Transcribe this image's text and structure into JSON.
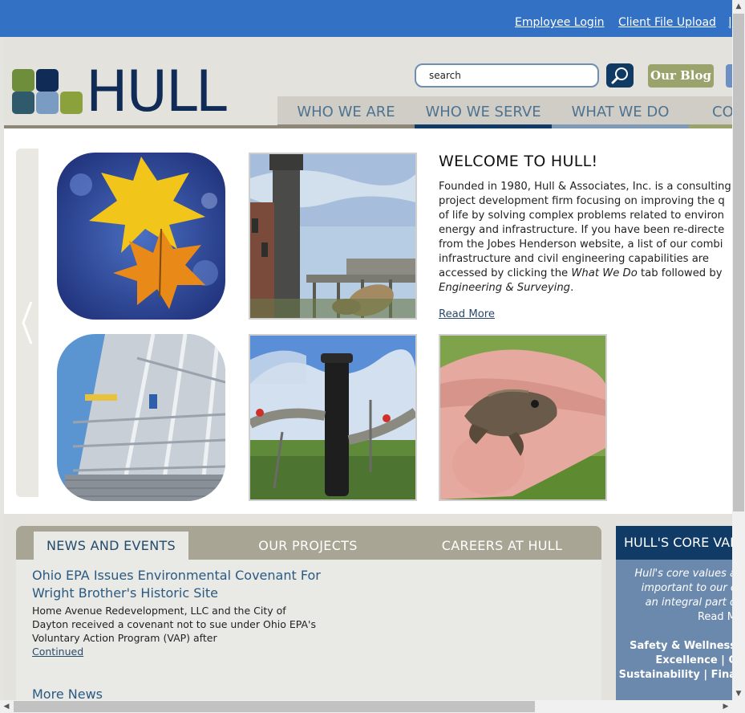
{
  "topbar": {
    "employee_login": "Employee Login",
    "client_upload": "Client File Upload"
  },
  "logo": {
    "wordmark": "HULL"
  },
  "search": {
    "value": "search",
    "icon": "magnifier-icon"
  },
  "blog_button": "Our Blog",
  "nav": {
    "tabs": [
      {
        "label": "WHO WE ARE",
        "underline": "#8d8779"
      },
      {
        "label": "WHO WE SERVE",
        "underline": "#103b66"
      },
      {
        "label": "WHAT WE DO",
        "underline": "#7f9ab7"
      },
      {
        "label": "CO",
        "underline": "#9aa36c"
      }
    ]
  },
  "hero": {
    "welcome_title": "WELCOME TO HULL!",
    "paragraph_lines": [
      "Founded in 1980, Hull & Associates, Inc. is a consulting",
      "project development firm focusing on improving the q",
      "of life by solving complex problems related to environ",
      "energy and infrastructure.  If you have been re-directe",
      "from the Jobes Henderson website, a list of our combi",
      "infrastructure and civil engineering capabilities are",
      "accessed by clicking the ",
      "What We Do",
      " tab followed by",
      "Engineering & Surveying",
      "."
    ],
    "read_more": "Read More"
  },
  "news": {
    "tabs": [
      "NEWS AND EVENTS",
      "OUR PROJECTS",
      "CAREERS AT HULL"
    ],
    "title_line1": "Ohio EPA Issues Environmental Covenant For",
    "title_line2": "Wright Brother's Historic Site",
    "body_line1": "Home Avenue Redevelopment, LLC and the City of",
    "body_line2": "Dayton received a covenant not to sue under Ohio EPA's",
    "body_line3": "Voluntary Action Program (VAP) after",
    "continued": "Continued",
    "more_news": "More News"
  },
  "core": {
    "heading": "HULL'S CORE VALU",
    "intro_line1": "Hull's core values a",
    "intro_line2": "important to our c",
    "intro_line3": "an integral part o",
    "read_more": "Read M",
    "values_line1": "Safety & Wellness",
    "values_line2": "Excellence  |  C",
    "values_line3": "Sustainability  |  Fina"
  },
  "colors": {
    "topbar": "#3371c4",
    "navy": "#0f2b56",
    "blog_green": "#9aa36c",
    "core_blue": "#6b89ad"
  }
}
